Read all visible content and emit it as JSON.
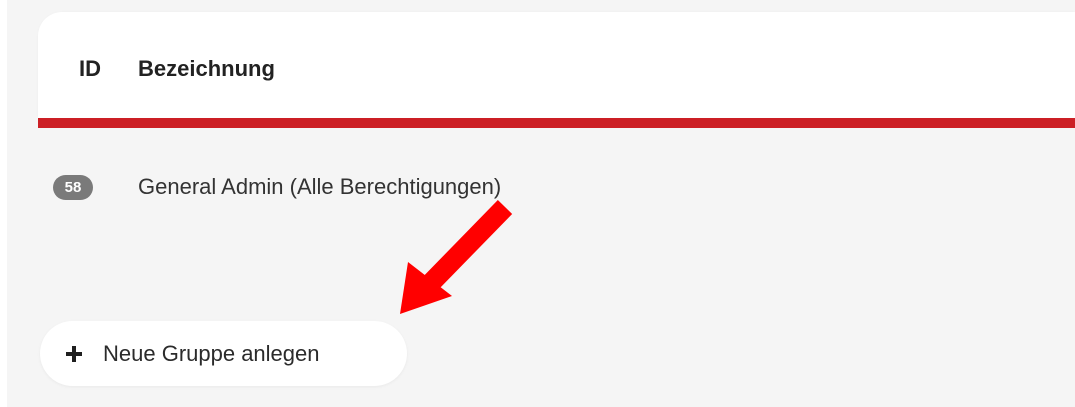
{
  "table": {
    "columns": {
      "id": "ID",
      "name": "Bezeichnung"
    },
    "rows": [
      {
        "id": "58",
        "name": "General Admin (Alle Berechtigungen)"
      }
    ]
  },
  "actions": {
    "new_group_label": "Neue Gruppe anlegen",
    "new_group_icon": "plus-icon"
  },
  "annotation": {
    "arrow_icon": "red-arrow-icon",
    "arrow_color": "#ff0000"
  },
  "colors": {
    "accent": "#cc1f25",
    "badge": "#7a7a7a",
    "panel": "#f5f5f5"
  }
}
